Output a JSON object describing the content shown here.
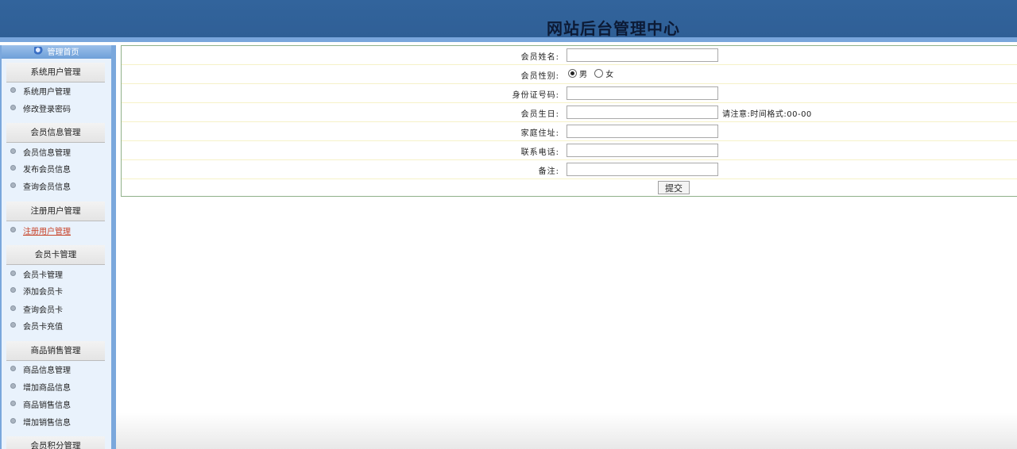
{
  "header": {
    "title": "网站后台管理中心"
  },
  "sidebar": {
    "top_label": "管理首页",
    "sections": [
      {
        "title": "系统用户管理",
        "items": [
          "系统用户管理",
          "修改登录密码"
        ]
      },
      {
        "title": "会员信息管理",
        "items": [
          "会员信息管理",
          "发布会员信息",
          "查询会员信息"
        ]
      },
      {
        "title": "注册用户管理",
        "items": [
          "注册用户管理"
        ]
      },
      {
        "title": "会员卡管理",
        "items": [
          "会员卡管理",
          "添加会员卡",
          "查询会员卡",
          "会员卡充值"
        ]
      },
      {
        "title": "商品销售管理",
        "items": [
          "商品信息管理",
          "增加商品信息",
          "商品销售信息",
          "增加销售信息"
        ]
      },
      {
        "title": "会员积分管理",
        "items": []
      }
    ]
  },
  "form": {
    "name_label": "会员姓名:",
    "name_value": "",
    "gender_label": "会员性别:",
    "gender_male": "男",
    "gender_female": "女",
    "id_label": "身份证号码:",
    "id_value": "",
    "birthday_label": "会员生日:",
    "birthday_value": "",
    "birthday_hint": "请注意:时间格式:00-00",
    "address_label": "家庭住址:",
    "address_value": "",
    "phone_label": "联系电话:",
    "phone_value": "",
    "note_label": "备注:",
    "note_value": "",
    "submit_label": "提交"
  }
}
